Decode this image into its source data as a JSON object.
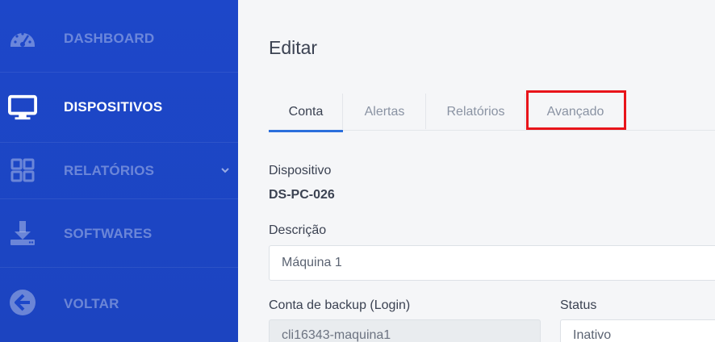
{
  "sidebar": {
    "items": [
      {
        "id": "dashboard",
        "label": "DASHBOARD",
        "icon": "dashboard-gauge-icon",
        "active": false
      },
      {
        "id": "dispositivos",
        "label": "DISPOSITIVOS",
        "icon": "monitor-icon",
        "active": true
      },
      {
        "id": "relatorios",
        "label": "RELATÓRIOS",
        "icon": "grid-icon",
        "active": false,
        "has_submenu": true
      },
      {
        "id": "softwares",
        "label": "SOFTWARES",
        "icon": "download-icon",
        "active": false
      },
      {
        "id": "voltar",
        "label": "VOLTAR",
        "icon": "arrow-left-circle-icon",
        "active": false
      }
    ]
  },
  "main": {
    "title": "Editar",
    "tabs": [
      {
        "label": "Conta",
        "active": true
      },
      {
        "label": "Alertas",
        "active": false
      },
      {
        "label": "Relatórios",
        "active": false
      },
      {
        "label": "Avançado",
        "active": false,
        "highlighted": true
      }
    ],
    "form": {
      "dispositivo_label": "Dispositivo",
      "dispositivo_value": "DS-PC-026",
      "descricao_label": "Descrição",
      "descricao_value": "Máquina 1",
      "backup_label": "Conta de backup (Login)",
      "backup_value": "cli16343-maquina1",
      "status_label": "Status",
      "status_value": "Inativo"
    }
  },
  "colors": {
    "sidebar_bg": "#1d47c9",
    "accent": "#2b6fdc",
    "highlight": "#e8141a"
  }
}
